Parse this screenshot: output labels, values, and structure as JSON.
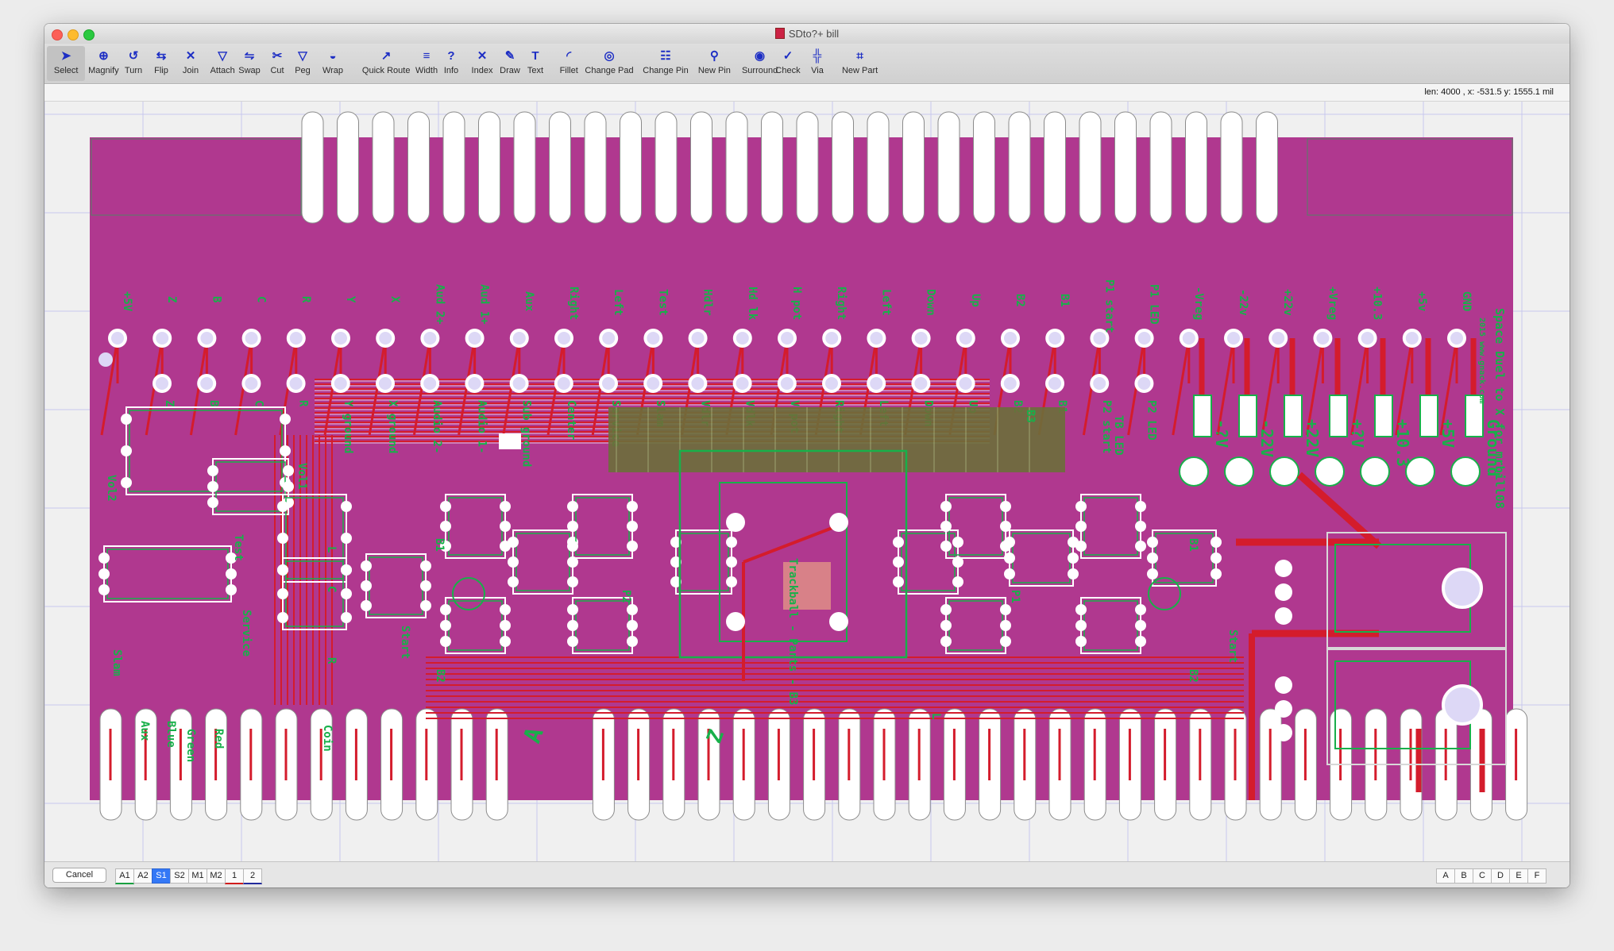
{
  "window": {
    "title": "SDto?+ bill"
  },
  "toolbar": {
    "tools": [
      {
        "label": "Select",
        "icon": "arrow-select-icon"
      },
      {
        "label": "Magnify",
        "icon": "magnify-icon"
      },
      {
        "label": "Turn",
        "icon": "turn-icon"
      },
      {
        "label": "Flip",
        "icon": "flip-icon"
      },
      {
        "label": "Join",
        "icon": "join-icon"
      },
      {
        "label": "Attach",
        "icon": "attach-icon"
      },
      {
        "label": "Swap",
        "icon": "swap-icon"
      },
      {
        "label": "Cut",
        "icon": "cut-icon"
      },
      {
        "label": "Peg",
        "icon": "peg-icon"
      },
      {
        "label": "Wrap",
        "icon": "wrap-icon"
      },
      {
        "label": "Quick Route",
        "icon": "quick-route-icon"
      },
      {
        "label": "Width",
        "icon": "width-icon"
      },
      {
        "label": "Info",
        "icon": "info-icon"
      },
      {
        "label": "Index",
        "icon": "index-icon"
      },
      {
        "label": "Draw",
        "icon": "draw-icon"
      },
      {
        "label": "Text",
        "icon": "text-icon"
      },
      {
        "label": "Fillet",
        "icon": "fillet-icon"
      },
      {
        "label": "Change Pad",
        "icon": "change-pad-icon"
      },
      {
        "label": "Change Pin",
        "icon": "change-pin-icon"
      },
      {
        "label": "New Pin",
        "icon": "new-pin-icon"
      },
      {
        "label": "Surround",
        "icon": "surround-icon"
      },
      {
        "label": "Check",
        "icon": "check-icon"
      },
      {
        "label": "Via",
        "icon": "via-icon"
      },
      {
        "label": "New Part",
        "icon": "new-part-icon"
      }
    ],
    "selected": "Select"
  },
  "status": {
    "coordinates": "len:  4000  ,  x: -531.5  y: 1555.1 mil"
  },
  "board": {
    "colors": {
      "board": "#b0388f",
      "copper": "#d41c2c",
      "silkscreen": "#18b04a",
      "grid": "#c8c8ee",
      "pad": "#ffffff",
      "padhole": "#ddd8f6",
      "part": "#6b6f3a"
    },
    "top_labels": [
      "+5V",
      "Z",
      "B",
      "C",
      "R",
      "Y",
      "X",
      "Aud 2+",
      "Aud 1+",
      "Aux",
      "Right",
      "Left",
      "Test",
      "Hdlr",
      "Hd lk",
      "H pot",
      "Right",
      "Left",
      "Down",
      "Up",
      "B2",
      "B1",
      "P1 start",
      "P1 LED",
      "-Vreg",
      "-22v",
      "+22v",
      "+Vreg",
      "+10.3",
      "+5v",
      "GND"
    ],
    "inner_labels": [
      "Z",
      "B",
      "C",
      "R",
      "Y ground",
      "X ground",
      "Audio 2-",
      "Audio 1-",
      "Sub ground",
      "Center",
      "Service",
      "Slam",
      "Vdlr",
      "Vdlk",
      "V pot",
      "Right",
      "Left",
      "Down",
      "Up",
      "B2",
      "B1",
      "P2 start",
      "P2 LED"
    ],
    "supply_labels": [
      "-?V",
      "-22V",
      "+22V",
      "+?V",
      "+10.3",
      "+5V",
      "Ground"
    ],
    "side_title": "Space Duel to X for mrbill08",
    "side_subtitle": "2015 www.gnack.com",
    "other_labels": {
      "vol2": "Vol2",
      "vol1": "Vol1",
      "test": "Test",
      "slam": "Slam",
      "service": "Service",
      "aux": "Aux",
      "blue": "Blue",
      "green": "Green",
      "red": "Red",
      "coin": "Coin",
      "start1": "Start",
      "b2a": "B2",
      "b1a": "B1",
      "p2": "P2",
      "p1": "P1",
      "trackball": "Trackball - Parts - B3",
      "b1b": "B1",
      "b2b": "B2",
      "start2": "Start",
      "ta": "A",
      "tz": "Z",
      "coin2": "Coin",
      "l": "L",
      "c": "C",
      "r": "R",
      "b3": "B3",
      "tbled": "TB LED",
      "l2": "L"
    },
    "bottom_finger_count": 39
  },
  "bottom": {
    "cancel_label": "Cancel",
    "layers": [
      "A1",
      "A2",
      "S1",
      "S2",
      "M1",
      "M2",
      "1",
      "2"
    ],
    "active_layer": "S1",
    "right_letters": [
      "A",
      "B",
      "C",
      "D",
      "E",
      "F"
    ]
  }
}
